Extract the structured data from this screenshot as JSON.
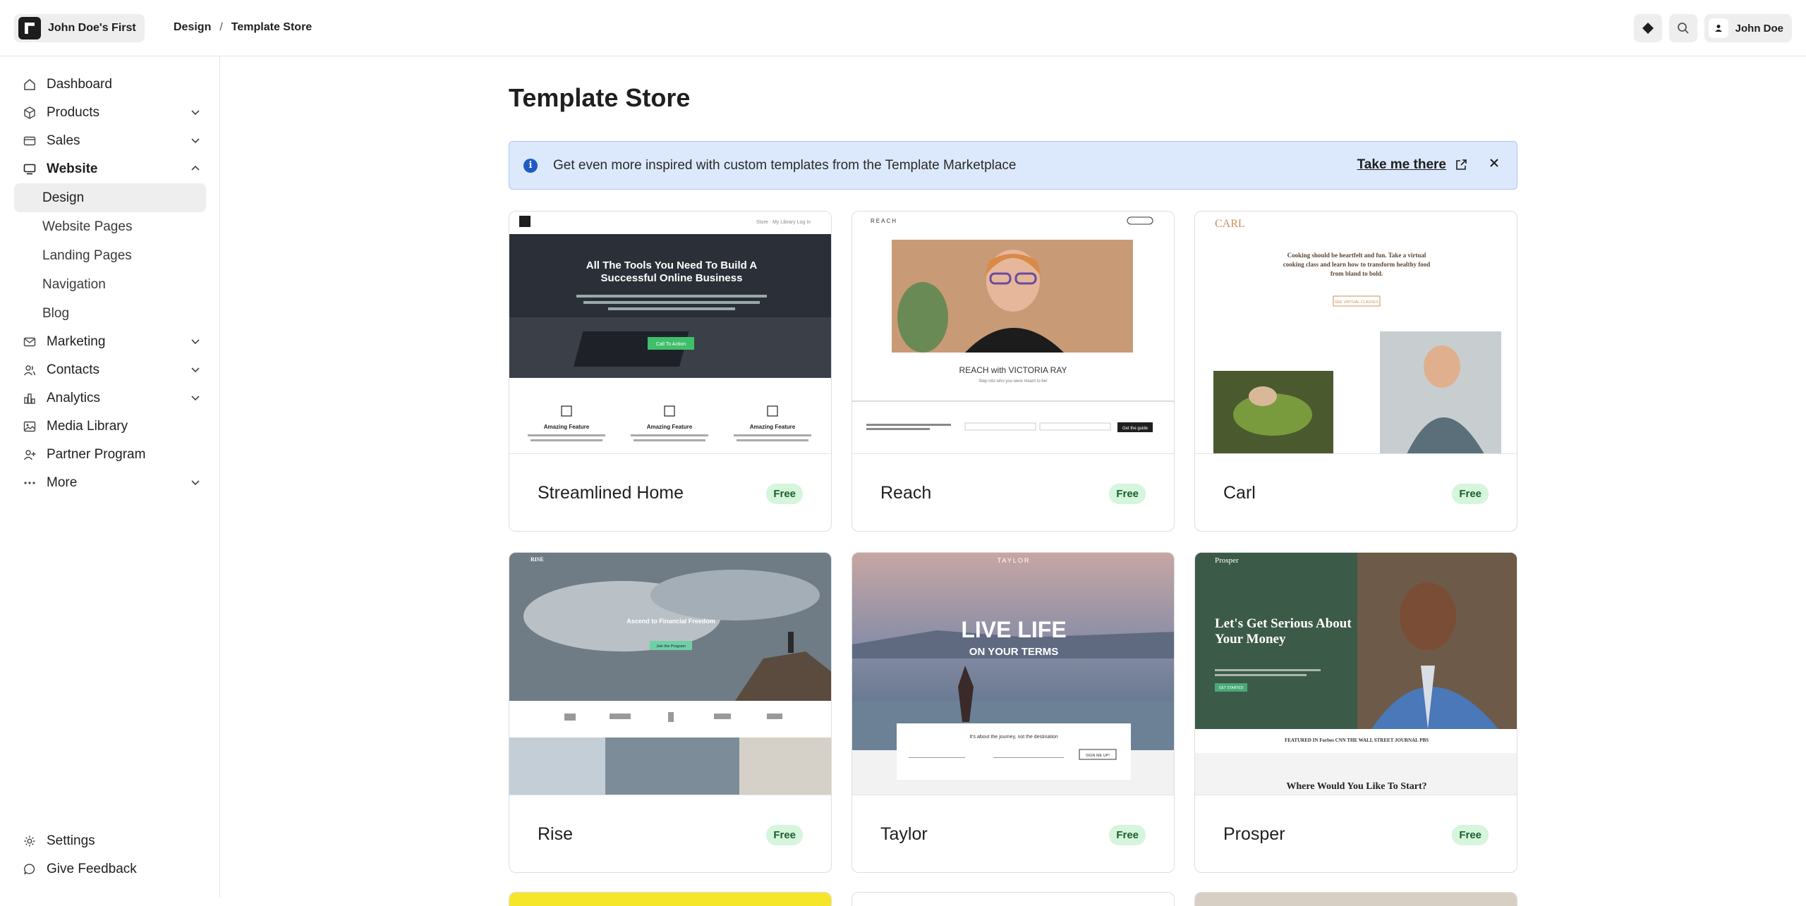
{
  "header": {
    "site_name": "John Doe's First",
    "breadcrumb": [
      "Design",
      "Template Store"
    ],
    "breadcrumb_sep": "/",
    "user_name": "John Doe"
  },
  "sidebar": {
    "items": [
      {
        "label": "Dashboard",
        "icon": "home-icon"
      },
      {
        "label": "Products",
        "icon": "box-icon",
        "expandable": true
      },
      {
        "label": "Sales",
        "icon": "card-icon",
        "expandable": true
      },
      {
        "label": "Website",
        "icon": "monitor-icon",
        "expanded": true,
        "children": [
          "Design",
          "Website Pages",
          "Landing Pages",
          "Navigation",
          "Blog"
        ],
        "active_child": "Design"
      },
      {
        "label": "Marketing",
        "icon": "mail-icon",
        "expandable": true
      },
      {
        "label": "Contacts",
        "icon": "users-icon",
        "expandable": true
      },
      {
        "label": "Analytics",
        "icon": "bar-chart-icon",
        "expandable": true
      },
      {
        "label": "Media Library",
        "icon": "image-icon"
      },
      {
        "label": "Partner Program",
        "icon": "user-plus-icon"
      },
      {
        "label": "More",
        "icon": "dots-icon",
        "expandable": true
      }
    ],
    "bottom": [
      {
        "label": "Settings",
        "icon": "gear-icon"
      },
      {
        "label": "Give Feedback",
        "icon": "chat-icon"
      }
    ]
  },
  "main": {
    "title": "Template Store",
    "banner": {
      "message": "Get even more inspired with custom templates from the Template Marketplace",
      "link": "Take me there"
    },
    "templates": [
      {
        "name": "Streamlined Home",
        "price": "Free",
        "preview": {
          "nav": "Store  ·  My Library          Log In",
          "headline": "All The Tools You Need To Build A Successful Online Business",
          "cta": "Call To Action",
          "feature": "Amazing Feature"
        }
      },
      {
        "name": "Reach",
        "price": "Free",
        "preview": {
          "brand": "REACH",
          "caption": "REACH with VICTORIA RAY",
          "sub": "Step into who you were meant to be!",
          "button": "Get the guide"
        }
      },
      {
        "name": "Carl",
        "price": "Free",
        "preview": {
          "brand": "CARL",
          "text": "Cooking should be heartfelt and fun. Take a virtual cooking class and learn how to transform healthy food from bland to bold.",
          "button": "SEE VIRTUAL CLASSES"
        }
      },
      {
        "name": "Rise",
        "price": "Free",
        "preview": {
          "brand": "RISE",
          "headline": "Ascend to Financial Freedom",
          "button": "Join the Program"
        }
      },
      {
        "name": "Taylor",
        "price": "Free",
        "preview": {
          "brand": "TAYLOR",
          "headline": "LIVE LIFE",
          "sub": "ON YOUR TERMS",
          "text": "It's about the journey, not the destination",
          "button": "SIGN ME UP!"
        }
      },
      {
        "name": "Prosper",
        "price": "Free",
        "preview": {
          "brand": "Prosper",
          "headline": "Let's Get Serious About Your Money",
          "button": "GET STARTED",
          "press": "FEATURED IN   Forbes   CNN   THE WALL STREET JOURNAL   PBS",
          "footer": "Where Would You Like To Start?"
        }
      }
    ]
  },
  "colors": {
    "accent_banner": "#dce9fc",
    "badge_bg": "#d6f5dd",
    "badge_text": "#1b5e2d"
  }
}
